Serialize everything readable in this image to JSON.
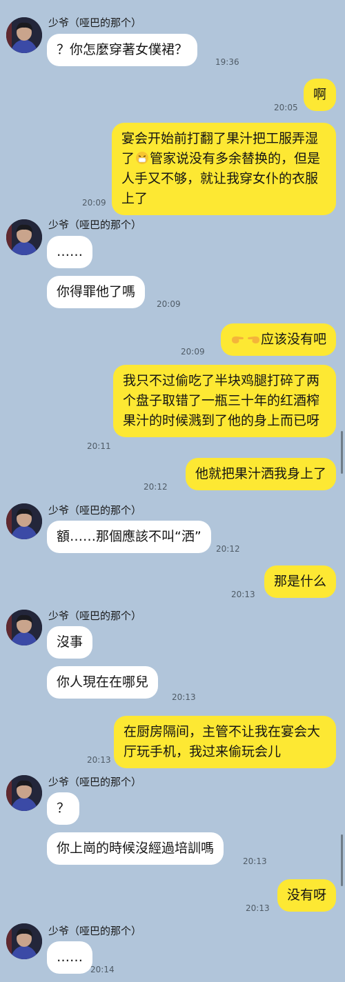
{
  "contact": {
    "name": "少爷（哑巴的那个）"
  },
  "messages": [
    {
      "id": "m1",
      "from": "contact",
      "text": "？你怎麼穿著女僕裙？",
      "time": "19:36"
    },
    {
      "id": "m2",
      "from": "me",
      "text": "啊",
      "time": "20:05"
    },
    {
      "id": "m3",
      "from": "me",
      "text_parts": [
        "宴会开始前打翻了果汁把工服弄湿了",
        "管家说没有多余替换的，但是人手又不够，就让我穿女仆的衣服上了"
      ],
      "emoji": "sneezing-face",
      "time": "20:09"
    },
    {
      "id": "m4",
      "from": "contact",
      "text": "……",
      "time": ""
    },
    {
      "id": "m5",
      "from": "contact",
      "text": "你得罪他了嗎",
      "time": "20:09"
    },
    {
      "id": "m6",
      "from": "me",
      "text": "应该没有吧",
      "emoji": "pointing-hands",
      "time": "20:09"
    },
    {
      "id": "m7",
      "from": "me",
      "text": "我只不过偷吃了半块鸡腿打碎了两个盘子取错了一瓶三十年的红酒榨果汁的时候溅到了他的身上而已呀",
      "time": "20:11"
    },
    {
      "id": "m8",
      "from": "me",
      "text": "他就把果汁洒我身上了",
      "time": "20:12"
    },
    {
      "id": "m9",
      "from": "contact",
      "text": "額……那個應該不叫“洒”",
      "time": "20:12"
    },
    {
      "id": "m10",
      "from": "me",
      "text": "那是什么",
      "time": "20:13"
    },
    {
      "id": "m11",
      "from": "contact",
      "text": "沒事",
      "time": ""
    },
    {
      "id": "m12",
      "from": "contact",
      "text": "你人現在在哪兒",
      "time": "20:13"
    },
    {
      "id": "m13",
      "from": "me",
      "text": "在厨房隔间，主管不让我在宴会大厅玩手机，我过来偷玩会儿",
      "time": "20:13"
    },
    {
      "id": "m14",
      "from": "contact",
      "text": "？",
      "time": ""
    },
    {
      "id": "m15",
      "from": "contact",
      "text": "你上崗的時候沒經過培訓嗎",
      "time": "20:13"
    },
    {
      "id": "m16",
      "from": "me",
      "text": "没有呀",
      "time": "20:13"
    },
    {
      "id": "m17",
      "from": "contact",
      "text": "……",
      "time": "20:14"
    }
  ],
  "colors": {
    "background": "#b1c5da",
    "incoming_bubble": "#ffffff",
    "outgoing_bubble": "#fde833"
  }
}
